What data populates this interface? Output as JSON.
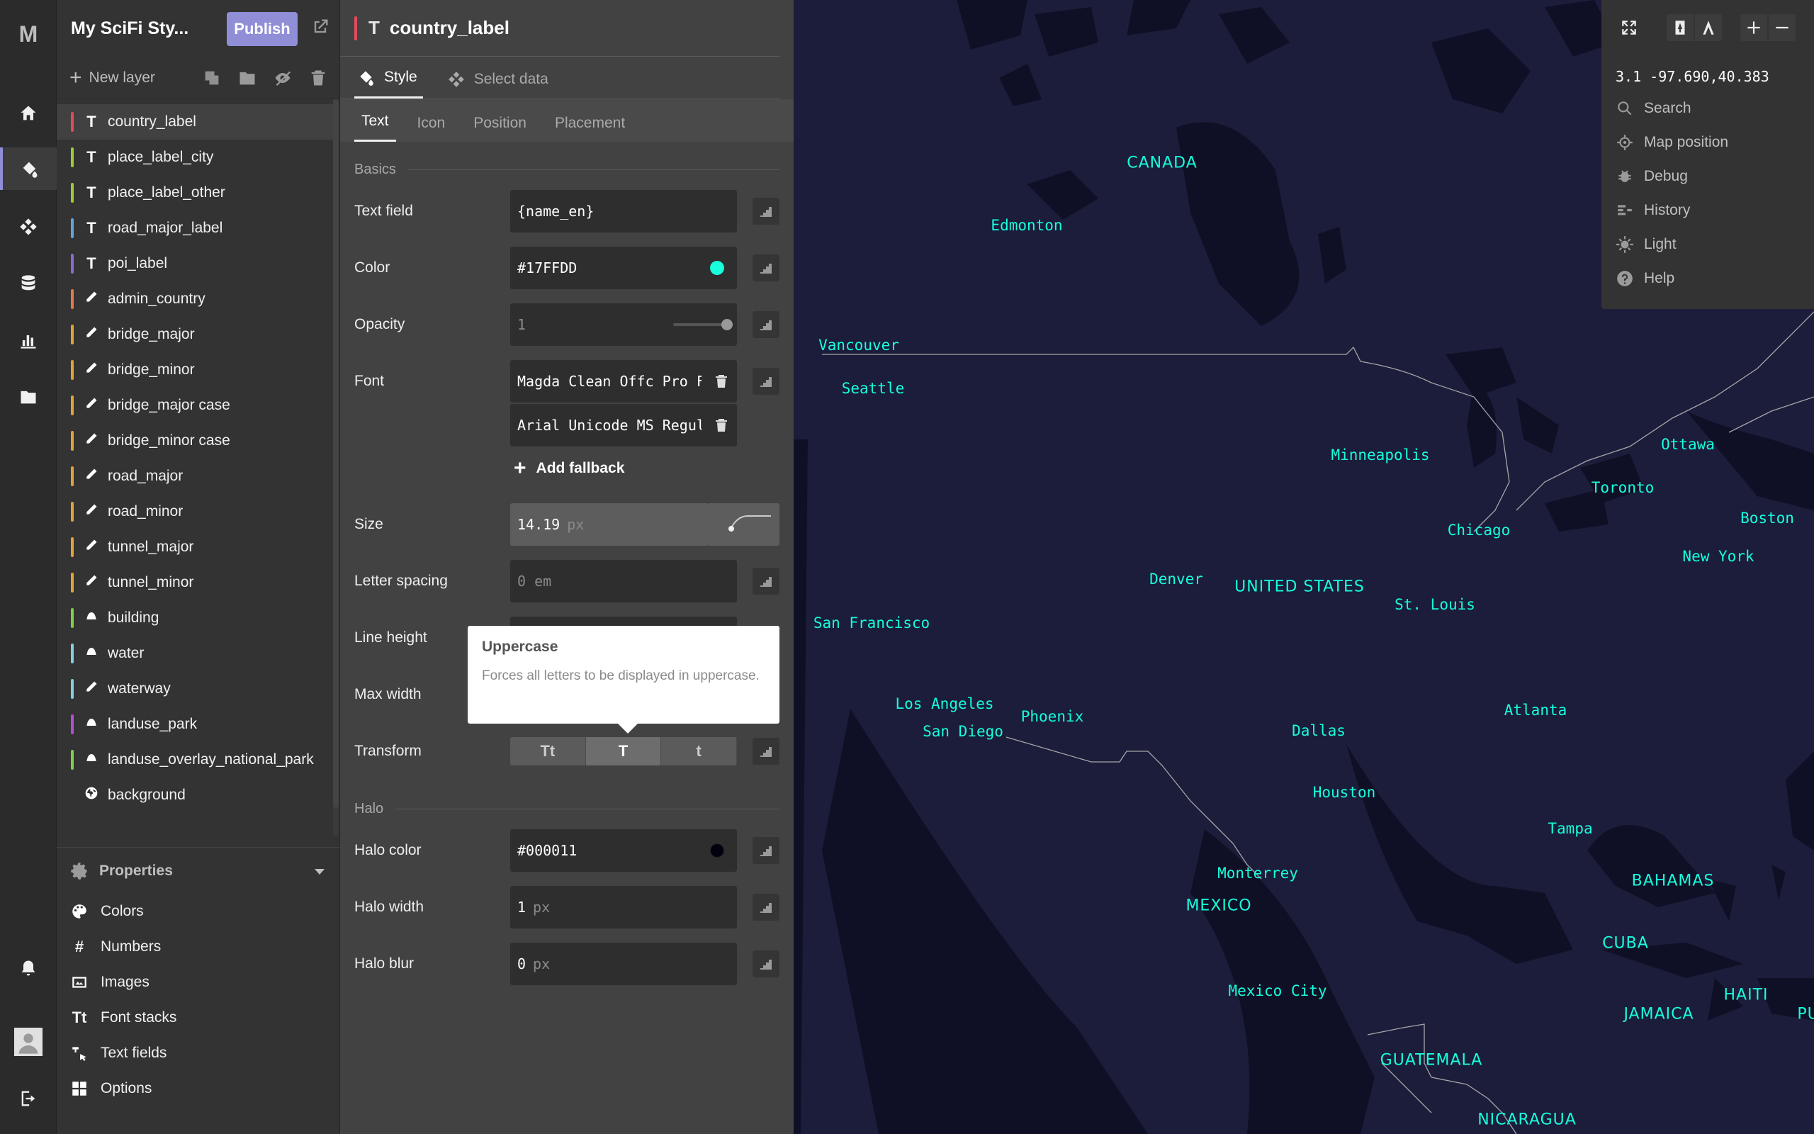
{
  "rail": {
    "logo": "M"
  },
  "layers_panel": {
    "style_name": "My SciFi Sty...",
    "publish_label": "Publish",
    "new_layer_label": "New layer",
    "layers": [
      {
        "name": "country_label",
        "type": "text",
        "color": "#e04b5c",
        "selected": true
      },
      {
        "name": "place_label_city",
        "type": "text",
        "color": "#9acd32"
      },
      {
        "name": "place_label_other",
        "type": "text",
        "color": "#9acd32"
      },
      {
        "name": "road_major_label",
        "type": "text",
        "color": "#5aa7d8"
      },
      {
        "name": "poi_label",
        "type": "text",
        "color": "#8a6ad6"
      },
      {
        "name": "admin_country",
        "type": "line",
        "color": "#e07a4b"
      },
      {
        "name": "bridge_major",
        "type": "line",
        "color": "#e0a33c"
      },
      {
        "name": "bridge_minor",
        "type": "line",
        "color": "#e0a33c"
      },
      {
        "name": "bridge_major case",
        "type": "line",
        "color": "#e0a33c"
      },
      {
        "name": "bridge_minor case",
        "type": "line",
        "color": "#e0a33c"
      },
      {
        "name": "road_major",
        "type": "line",
        "color": "#e0a33c"
      },
      {
        "name": "road_minor",
        "type": "line",
        "color": "#e0a33c"
      },
      {
        "name": "tunnel_major",
        "type": "line",
        "color": "#e0a33c"
      },
      {
        "name": "tunnel_minor",
        "type": "line",
        "color": "#e0a33c"
      },
      {
        "name": "building",
        "type": "fill",
        "color": "#7fcf4a"
      },
      {
        "name": "water",
        "type": "fill",
        "color": "#7fd0e0"
      },
      {
        "name": "waterway",
        "type": "line",
        "color": "#7fd0e0"
      },
      {
        "name": "landuse_park",
        "type": "fill",
        "color": "#b24fd6"
      },
      {
        "name": "landuse_overlay_national_park",
        "type": "fill",
        "color": "#7fcf4a"
      },
      {
        "name": "background",
        "type": "background",
        "color": ""
      }
    ],
    "properties_label": "Properties",
    "properties_items": [
      {
        "label": "Colors",
        "icon": "palette-icon"
      },
      {
        "label": "Numbers",
        "icon": "hash-icon"
      },
      {
        "label": "Images",
        "icon": "image-icon"
      },
      {
        "label": "Font stacks",
        "icon": "font-icon"
      },
      {
        "label": "Text fields",
        "icon": "text-field-icon"
      },
      {
        "label": "Options",
        "icon": "grid-icon"
      }
    ]
  },
  "style_panel": {
    "layer_title": "country_label",
    "tab_style": "Style",
    "tab_select_data": "Select data",
    "subtabs": [
      "Text",
      "Icon",
      "Position",
      "Placement"
    ],
    "section_basics": "Basics",
    "text_field_label": "Text field",
    "text_field_value": "{name_en}",
    "color_label": "Color",
    "color_value": "#17FFDD",
    "opacity_label": "Opacity",
    "opacity_value": "1",
    "font_label": "Font",
    "font_1": "Magda Clean Offc Pro F",
    "font_2": "Arial Unicode MS Regul",
    "add_fallback_label": "Add fallback",
    "size_label": "Size",
    "size_value": "14.19",
    "size_unit": "px",
    "letter_spacing_label": "Letter spacing",
    "letter_spacing_placeholder": "0 em",
    "line_height_label": "Line height",
    "max_width_label": "Max width",
    "transform_label": "Transform",
    "transform_options": [
      "Tt",
      "T",
      "t"
    ],
    "section_halo": "Halo",
    "halo_color_label": "Halo color",
    "halo_color_value": "#000011",
    "halo_width_label": "Halo width",
    "halo_width_value": "1",
    "halo_width_unit": "px",
    "halo_blur_label": "Halo blur",
    "halo_blur_value": "0",
    "halo_blur_unit": "px",
    "tooltip_title": "Uppercase",
    "tooltip_body": "Forces all letters to be displayed in uppercase."
  },
  "map": {
    "label_color": "#17ffdd",
    "countries": [
      "CANADA",
      "UNITED STATES",
      "MEXICO",
      "BAHAMAS",
      "CUBA",
      "JAMAICA",
      "HAITI",
      "GUATEMALA",
      "NICARAGUA",
      "PU"
    ],
    "cities": [
      "Edmonton",
      "Vancouver",
      "Seattle",
      "Minneapolis",
      "Ottawa",
      "Toronto",
      "Boston",
      "Chicago",
      "New York",
      "Denver",
      "St. Louis",
      "San Francisco",
      "Los Angeles",
      "San Diego",
      "Phoenix",
      "Atlanta",
      "Dallas",
      "Houston",
      "Tampa",
      "Monterrey",
      "Mexico City"
    ]
  },
  "map_controls": {
    "coords": "3.1 -97.690,40.383",
    "items": [
      "Search",
      "Map position",
      "Debug",
      "History",
      "Light",
      "Help"
    ]
  }
}
